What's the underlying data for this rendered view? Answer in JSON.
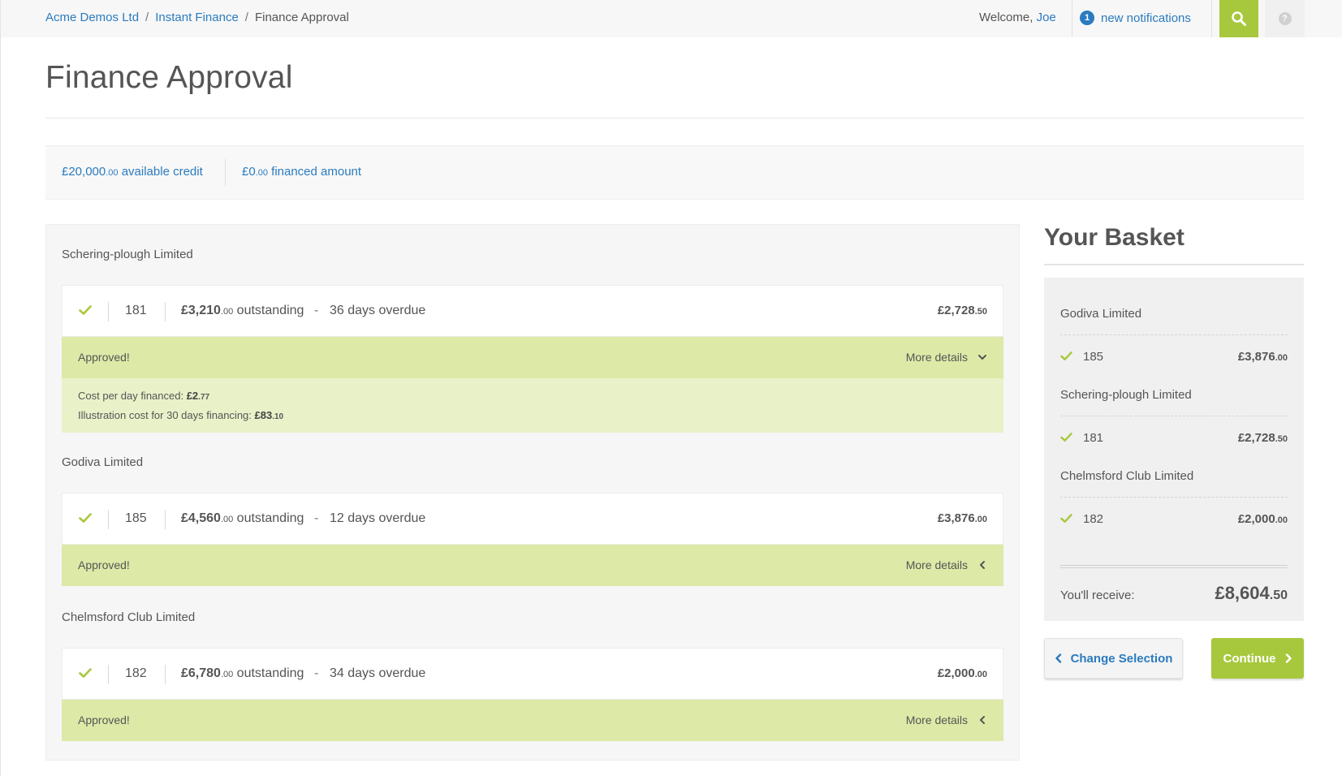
{
  "breadcrumb": {
    "items": [
      "Acme Demos Ltd",
      "Instant Finance",
      "Finance Approval"
    ],
    "separator": "/"
  },
  "header": {
    "welcome_prefix": "Welcome, ",
    "user_name": "Joe",
    "notification_count": "1",
    "notification_label": "new notifications",
    "help_glyph": "?",
    "icons": [
      "search-icon",
      "help-icon"
    ]
  },
  "page": {
    "title": "Finance Approval"
  },
  "credit": {
    "available_major": "£20,000",
    "available_minor": ".00",
    "available_label": " available credit",
    "financed_major": "£0",
    "financed_minor": ".00",
    "financed_label": " financed amount"
  },
  "invoices": [
    {
      "company": "Schering-plough Limited",
      "number": "181",
      "outstanding_major": "£3,210",
      "outstanding_minor": ".00",
      "outstanding_label": " outstanding",
      "dash": "-",
      "overdue": "36 days overdue",
      "amount_major": "£2,728",
      "amount_minor": ".50",
      "status": "Approved!",
      "more_details": "More details",
      "expanded": true,
      "cost_per_day_label": "Cost per day financed: ",
      "cost_per_day_major": "£2",
      "cost_per_day_minor": ".77",
      "illustration_label": "Illustration cost for 30 days financing: ",
      "illustration_major": "£83",
      "illustration_minor": ".10"
    },
    {
      "company": "Godiva Limited",
      "number": "185",
      "outstanding_major": "£4,560",
      "outstanding_minor": ".00",
      "outstanding_label": " outstanding",
      "dash": "-",
      "overdue": "12 days overdue",
      "amount_major": "£3,876",
      "amount_minor": ".00",
      "status": "Approved!",
      "more_details": "More details",
      "expanded": false
    },
    {
      "company": "Chelmsford Club Limited",
      "number": "182",
      "outstanding_major": "£6,780",
      "outstanding_minor": ".00",
      "outstanding_label": " outstanding",
      "dash": "-",
      "overdue": "34 days overdue",
      "amount_major": "£2,000",
      "amount_minor": ".00",
      "status": "Approved!",
      "more_details": "More details",
      "expanded": false
    }
  ],
  "basket": {
    "title": "Your Basket",
    "items": [
      {
        "company": "Godiva Limited",
        "number": "185",
        "amount_major": "£3,876",
        "amount_minor": ".00"
      },
      {
        "company": "Schering-plough Limited",
        "number": "181",
        "amount_major": "£2,728",
        "amount_minor": ".50"
      },
      {
        "company": "Chelmsford Club Limited",
        "number": "182",
        "amount_major": "£2,000",
        "amount_minor": ".00"
      }
    ],
    "receive_label": "You'll receive:",
    "total_major": "£8,604",
    "total_minor": ".50"
  },
  "actions": {
    "change_selection": "Change Selection",
    "continue": "Continue"
  },
  "colors": {
    "accent_green": "#a7c83c",
    "approved_bg": "#dde9a7",
    "details_bg": "#e9f1c9",
    "link_blue": "#2b7bbf"
  }
}
